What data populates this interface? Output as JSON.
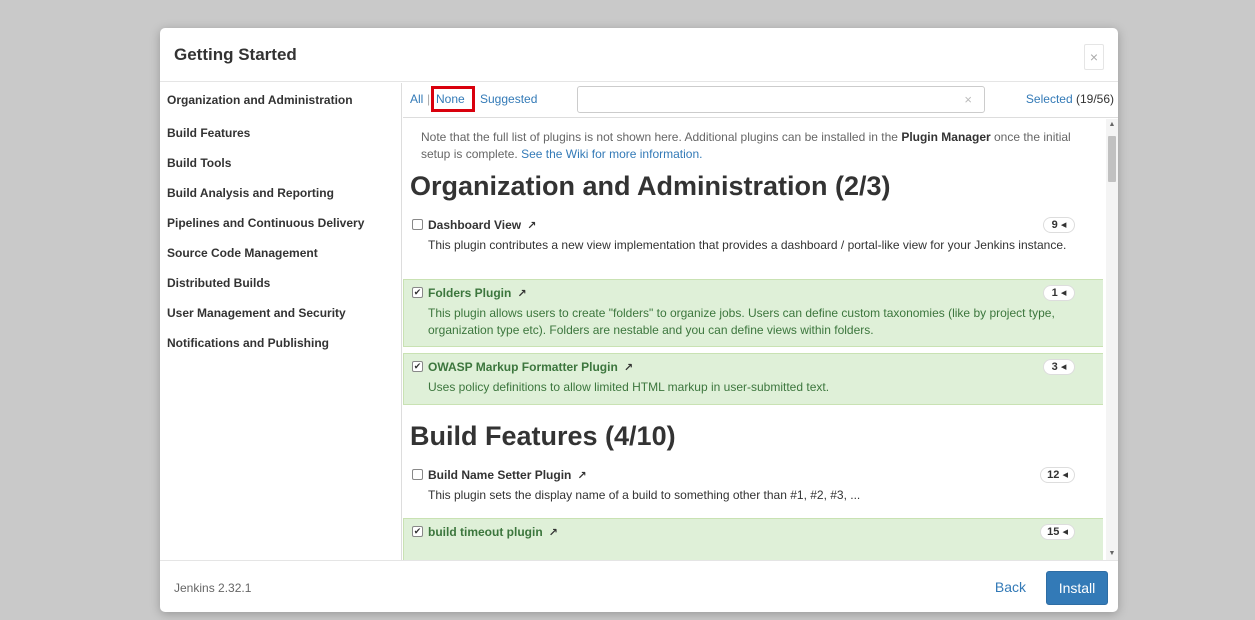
{
  "dialog": {
    "title": "Getting Started",
    "close_glyph": "×"
  },
  "sidebar": {
    "items": [
      {
        "label": "Organization and Administration"
      },
      {
        "label": "Build Features"
      },
      {
        "label": "Build Tools"
      },
      {
        "label": "Build Analysis and Reporting"
      },
      {
        "label": "Pipelines and Continuous Delivery"
      },
      {
        "label": "Source Code Management"
      },
      {
        "label": "Distributed Builds"
      },
      {
        "label": "User Management and Security"
      },
      {
        "label": "Notifications and Publishing"
      }
    ]
  },
  "toolbar": {
    "all_label": "All",
    "separator": "|",
    "none_label": "None",
    "suggested_label": "Suggested",
    "search_value": "",
    "search_clear": "×",
    "selected_label": "Selected",
    "selected_count": "(19/56)"
  },
  "note": {
    "text1": "Note that the full list of plugins is not shown here. Additional plugins can be installed in the ",
    "bold": "Plugin Manager",
    "text2": " once the initial setup is complete. ",
    "link": "See the Wiki for more information."
  },
  "sections": [
    {
      "title": "Organization and Administration (2/3)"
    },
    {
      "title": "Build Features (4/10)"
    }
  ],
  "plugins": [
    {
      "name": "Dashboard View",
      "checked": false,
      "deps": "9 ◂",
      "desc": "This plugin contributes a new view implementation that provides a dashboard / portal-like view for your Jenkins instance."
    },
    {
      "name": "Folders Plugin",
      "checked": true,
      "deps": "1 ◂",
      "desc": "This plugin allows users to create \"folders\" to organize jobs. Users can define custom taxonomies (like by project type, organization type etc). Folders are nestable and you can define views within folders."
    },
    {
      "name": "OWASP Markup Formatter Plugin",
      "checked": true,
      "deps": "3 ◂",
      "desc": "Uses policy definitions to allow limited HTML markup in user-submitted text."
    },
    {
      "name": "Build Name Setter Plugin",
      "checked": false,
      "deps": "12 ◂",
      "desc": "This plugin sets the display name of a build to something other than #1, #2, #3, ..."
    },
    {
      "name": "build timeout plugin",
      "checked": true,
      "deps": "15 ◂",
      "desc": ""
    }
  ],
  "icons": {
    "external_link": "↗",
    "checkmark": "✔",
    "scroll_up": "▲",
    "scroll_down": "▼"
  },
  "footer": {
    "version": "Jenkins 2.32.1",
    "back_label": "Back",
    "install_label": "Install"
  },
  "colors": {
    "accent": "#337ab7",
    "selected_bg": "#dff0d8",
    "selected_text": "#3c763d",
    "highlight": "#d9000d"
  }
}
